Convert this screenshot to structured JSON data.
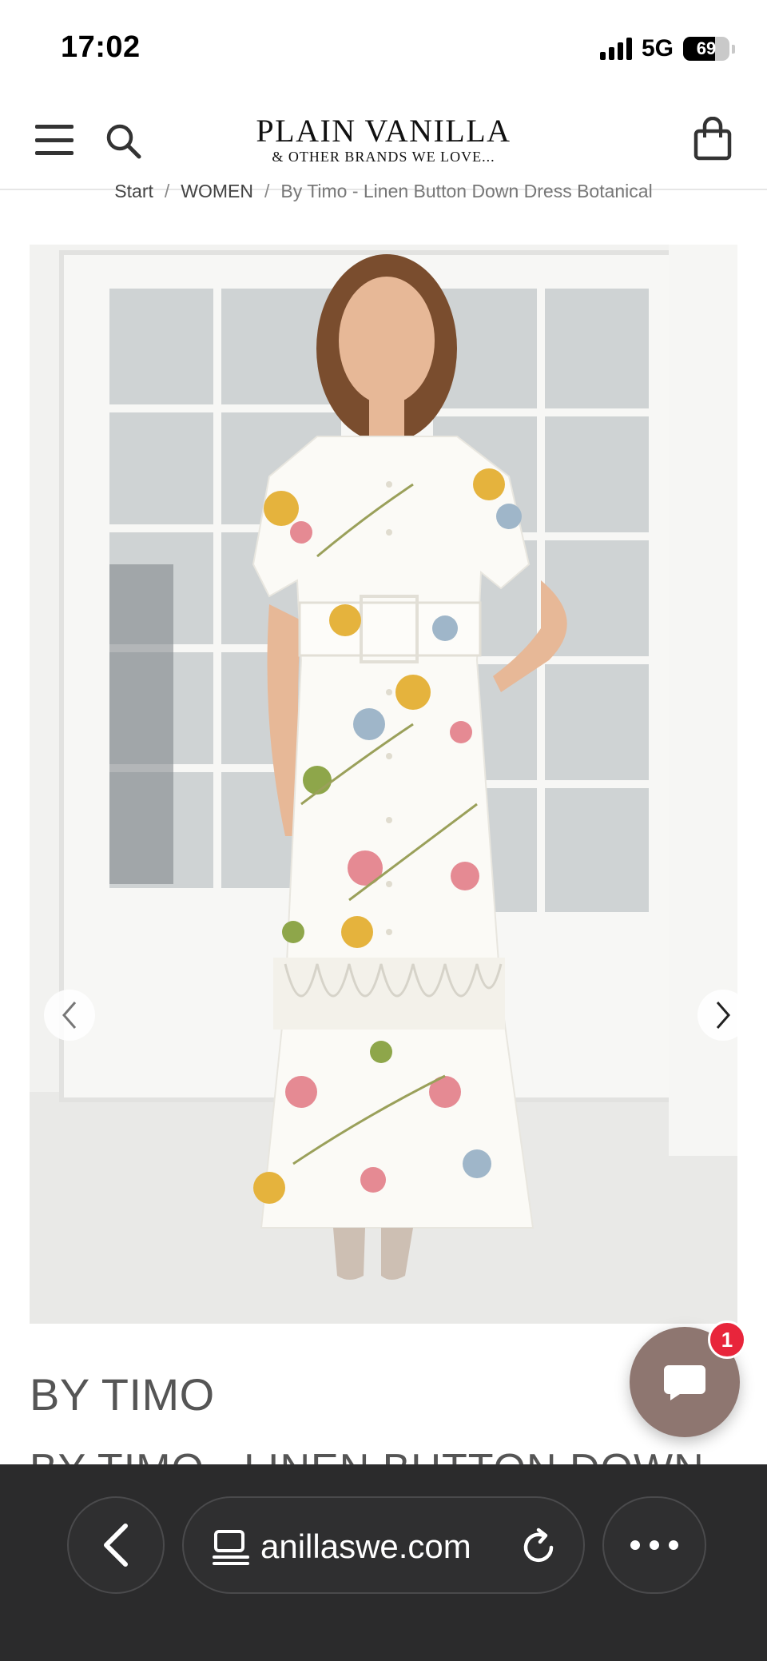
{
  "status_bar": {
    "time": "17:02",
    "network": "5G",
    "battery": "69",
    "battery_level_percent": 69
  },
  "header": {
    "logo_main": "PLAIN VANILLA",
    "logo_sub": "& OTHER BRANDS WE LOVE...",
    "icons": [
      "hamburger-menu-icon",
      "search-icon",
      "shopping-bag-icon"
    ]
  },
  "breadcrumb": {
    "items": [
      "Start",
      "WOMEN",
      "By Timo - Linen Button Down Dress Botanical"
    ],
    "separator": "/"
  },
  "gallery": {
    "image_alt": "Model wearing white floral linen button down maxi dress with belt and lace insert",
    "prev_icon": "chevron-left-icon",
    "next_icon": "chevron-right-icon"
  },
  "product": {
    "brand": "BY TIMO",
    "title": "BY TIMO - LINEN BUTTON DOWN"
  },
  "chat": {
    "badge_count": "1",
    "accent_color": "#8e7670",
    "badge_color": "#e8253b"
  },
  "browser": {
    "url": "anillaswe.com",
    "icons": [
      "back-chevron-icon",
      "tabs-icon",
      "reload-icon",
      "more-dots-icon"
    ]
  }
}
